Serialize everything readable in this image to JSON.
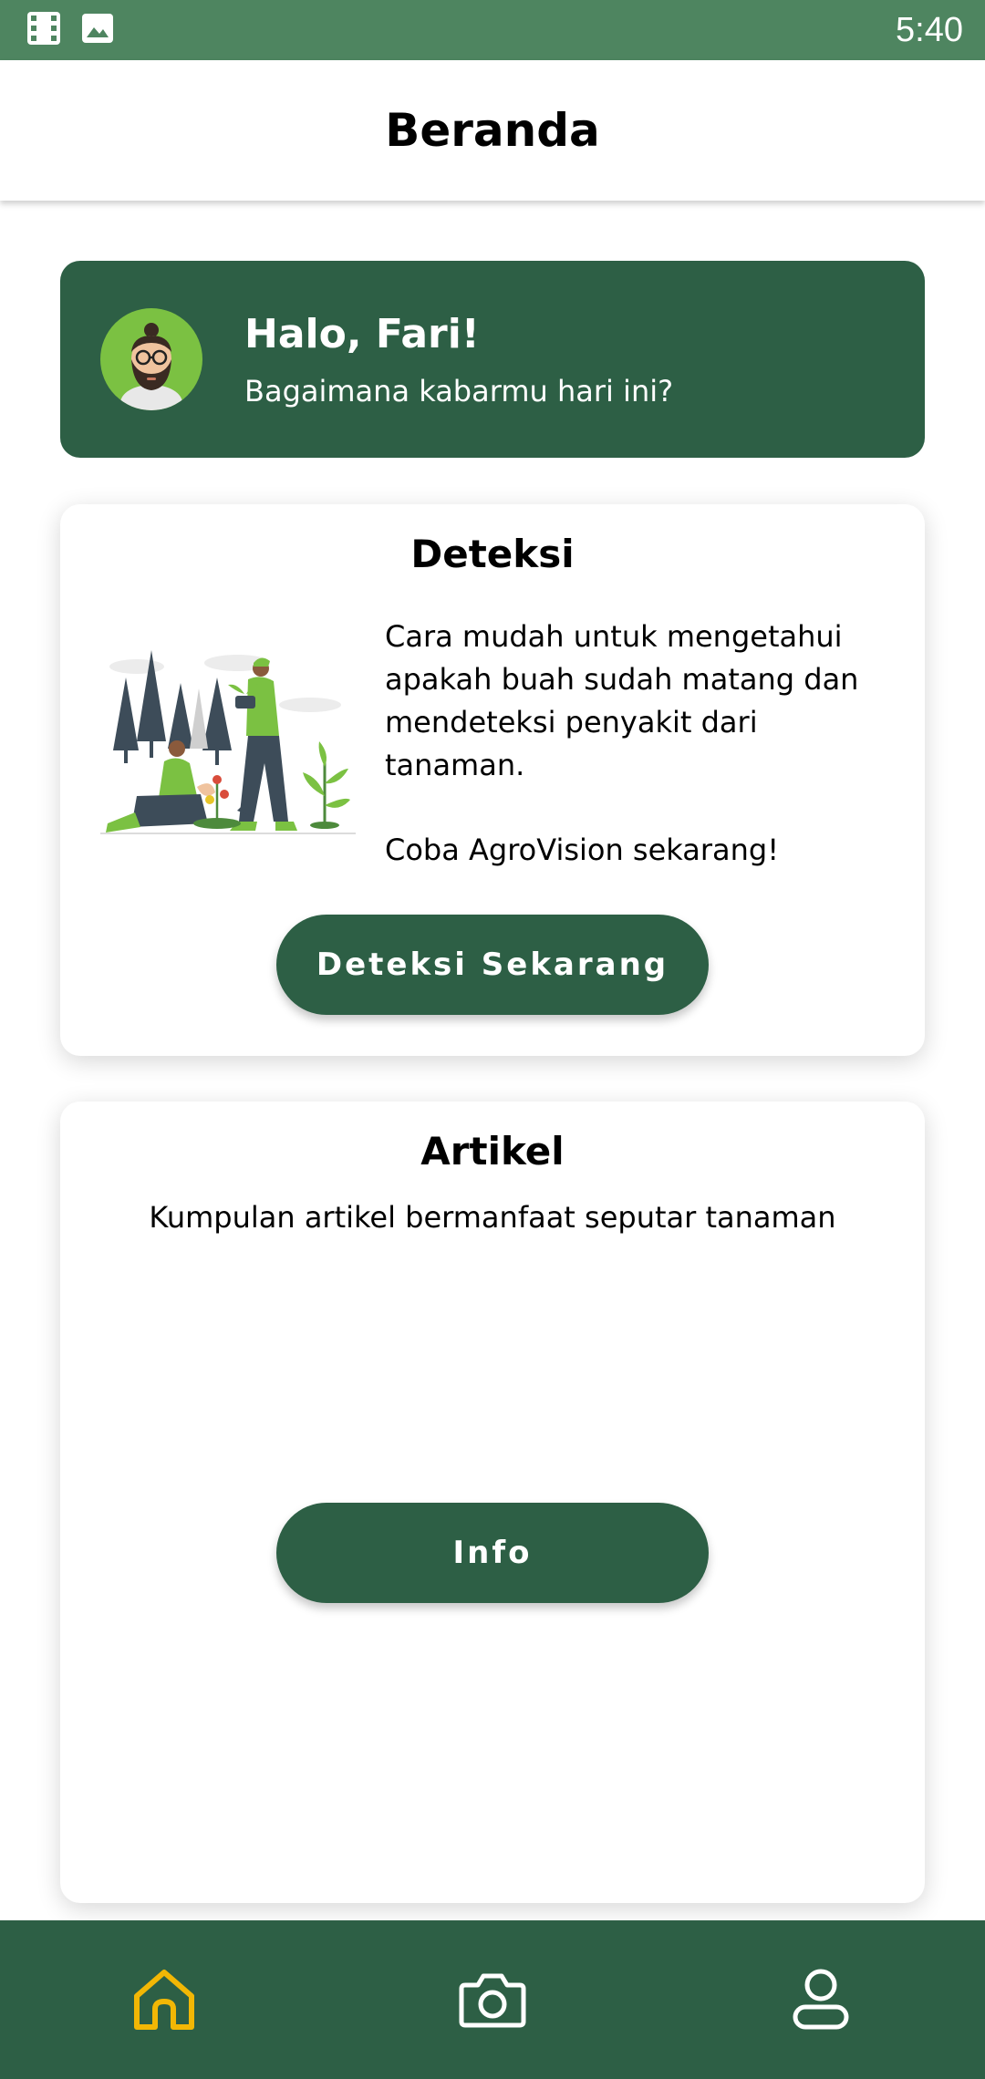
{
  "status_bar": {
    "time": "5:40",
    "icons": [
      "film-icon",
      "image-icon"
    ]
  },
  "app_bar": {
    "title": "Beranda"
  },
  "greeting": {
    "title": "Halo, Fari!",
    "subtitle": "Bagaimana kabarmu hari ini?"
  },
  "detect": {
    "title": "Deteksi",
    "description": "Cara mudah untuk mengetahui apakah buah sudah matang dan mendeteksi penyakit dari tanaman.",
    "cta": "Coba AgroVision sekarang!",
    "button_label": "Deteksi Sekarang"
  },
  "article": {
    "title": "Artikel",
    "subtitle": "Kumpulan artikel bermanfaat seputar tanaman",
    "button_label": "Info"
  },
  "bottom_nav": {
    "items": [
      "home-icon",
      "camera-icon",
      "profile-icon"
    ],
    "active": "home-icon"
  },
  "colors": {
    "status_bar": "#4e8560",
    "primary": "#2d5f45",
    "active_nav": "#f2b705",
    "avatar_bg": "#7bc142"
  }
}
